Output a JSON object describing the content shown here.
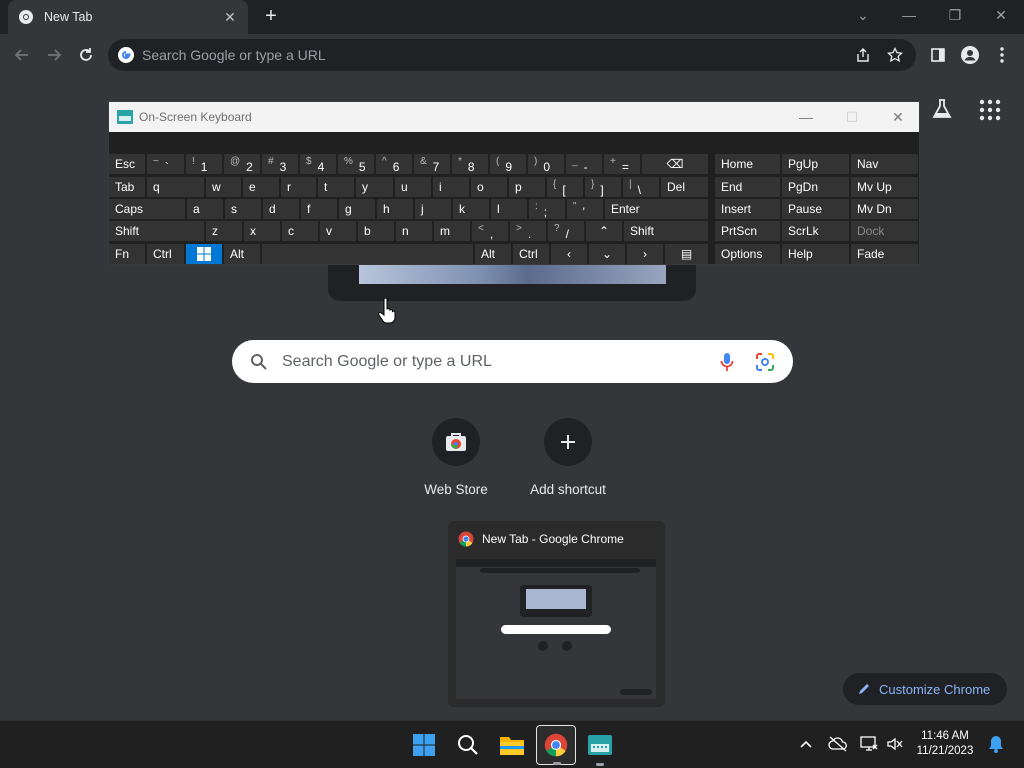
{
  "browser": {
    "tab_title": "New Tab",
    "omnibox_placeholder": "Search Google or type a URL"
  },
  "ntp": {
    "search_placeholder": "Search Google or type a URL",
    "shortcuts": [
      {
        "label": "Web Store"
      },
      {
        "label": "Add shortcut"
      }
    ],
    "customize_label": "Customize Chrome"
  },
  "preview": {
    "title": "New Tab - Google Chrome"
  },
  "osk": {
    "title": "On-Screen Keyboard",
    "rows": [
      [
        {
          "l": "Esc"
        },
        {
          "s": "~",
          "b": "`"
        },
        {
          "s": "!",
          "b": "1"
        },
        {
          "s": "@",
          "b": "2"
        },
        {
          "s": "#",
          "b": "3"
        },
        {
          "s": "$",
          "b": "4"
        },
        {
          "s": "%",
          "b": "5"
        },
        {
          "s": "^",
          "b": "6"
        },
        {
          "s": "&",
          "b": "7"
        },
        {
          "s": "*",
          "b": "8"
        },
        {
          "s": "(",
          "b": "9"
        },
        {
          "s": ")",
          "b": "0"
        },
        {
          "s": "_",
          "b": "-"
        },
        {
          "s": "+",
          "b": "="
        },
        {
          "l": "⌫"
        }
      ],
      [
        {
          "l": "Tab"
        },
        {
          "l": "q"
        },
        {
          "l": "w"
        },
        {
          "l": "e"
        },
        {
          "l": "r"
        },
        {
          "l": "t"
        },
        {
          "l": "y"
        },
        {
          "l": "u"
        },
        {
          "l": "i"
        },
        {
          "l": "o"
        },
        {
          "l": "p"
        },
        {
          "s": "{",
          "b": "["
        },
        {
          "s": "}",
          "b": "]"
        },
        {
          "s": "|",
          "b": "\\"
        },
        {
          "l": "Del"
        }
      ],
      [
        {
          "l": "Caps"
        },
        {
          "l": "a"
        },
        {
          "l": "s"
        },
        {
          "l": "d"
        },
        {
          "l": "f"
        },
        {
          "l": "g"
        },
        {
          "l": "h"
        },
        {
          "l": "j"
        },
        {
          "l": "k"
        },
        {
          "l": "l"
        },
        {
          "s": ":",
          "b": ";"
        },
        {
          "s": "\"",
          "b": "'"
        },
        {
          "l": "Enter"
        }
      ],
      [
        {
          "l": "Shift"
        },
        {
          "l": "z"
        },
        {
          "l": "x"
        },
        {
          "l": "c"
        },
        {
          "l": "v"
        },
        {
          "l": "b"
        },
        {
          "l": "n"
        },
        {
          "l": "m"
        },
        {
          "s": "<",
          "b": ","
        },
        {
          "s": ">",
          "b": "."
        },
        {
          "s": "?",
          "b": "/"
        },
        {
          "l": "⌃"
        },
        {
          "l": "Shift"
        }
      ],
      [
        {
          "l": "Fn"
        },
        {
          "l": "Ctrl"
        },
        {
          "l": "win-logo"
        },
        {
          "l": "Alt"
        },
        {
          "l": ""
        },
        {
          "l": "Alt"
        },
        {
          "l": "Ctrl"
        },
        {
          "l": "‹"
        },
        {
          "l": "⌄"
        },
        {
          "l": "›"
        },
        {
          "l": "▤"
        }
      ]
    ],
    "nav_keys": [
      [
        "Home",
        "PgUp",
        "Nav"
      ],
      [
        "End",
        "PgDn",
        "Mv Up"
      ],
      [
        "Insert",
        "Pause",
        "Mv Dn"
      ],
      [
        "PrtScn",
        "ScrLk",
        "Dock"
      ],
      [
        "Options",
        "Help",
        "Fade"
      ]
    ]
  },
  "taskbar": {
    "time": "11:46 AM",
    "date": "11/21/2023"
  }
}
